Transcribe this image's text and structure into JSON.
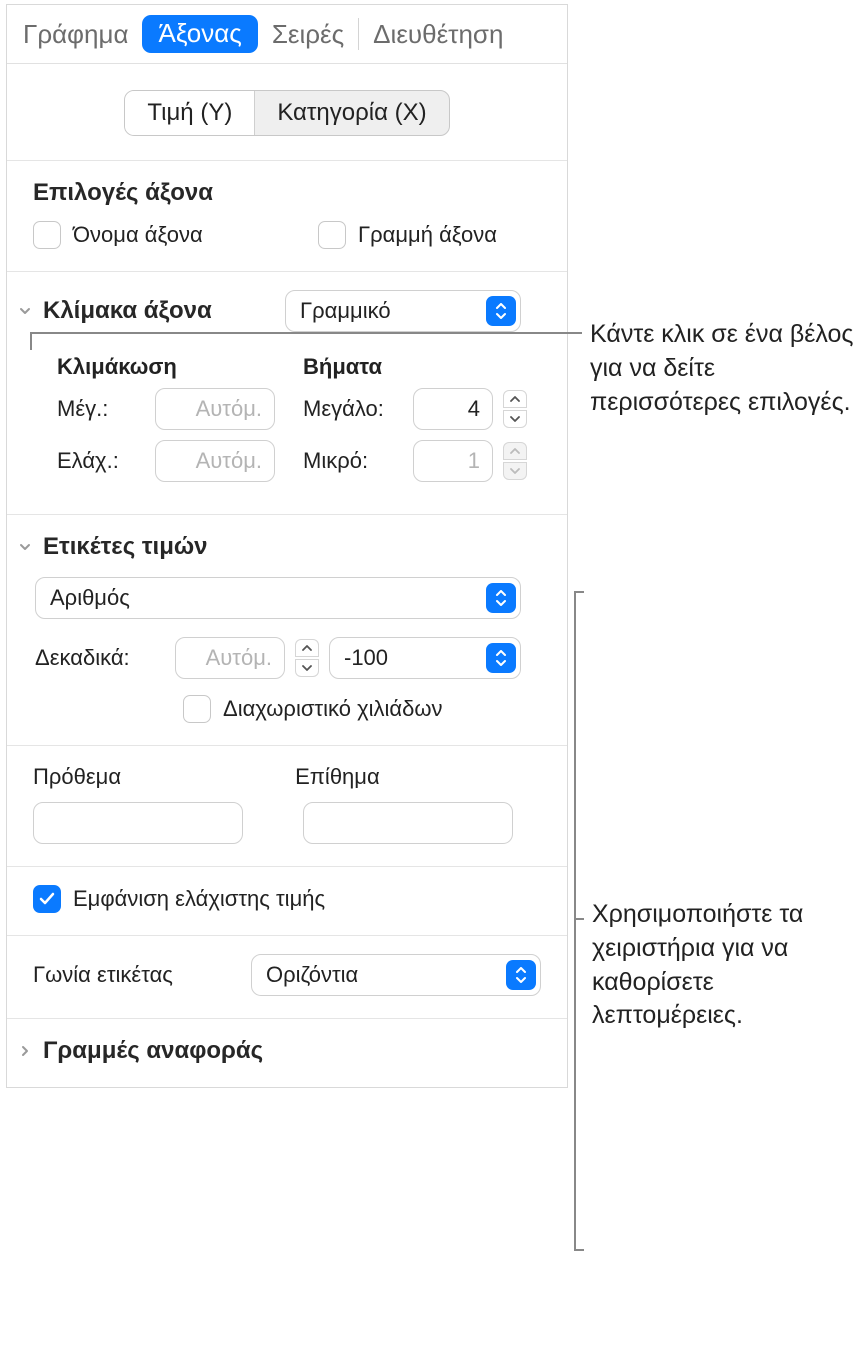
{
  "tabs": {
    "chart": "Γράφημα",
    "axis": "Άξονας",
    "series": "Σειρές",
    "arrange": "Διευθέτηση"
  },
  "segment": {
    "valueY": "Τιμή (Y)",
    "categoryX": "Κατηγορία (X)"
  },
  "axisOptions": {
    "title": "Επιλογές άξονα",
    "axisName": "Όνομα άξονα",
    "axisLine": "Γραμμή άξονα"
  },
  "scale": {
    "title": "Κλίμακα άξονα",
    "type": "Γραμμικό",
    "scalingTitle": "Κλιμάκωση",
    "maxLabel": "Μέγ.:",
    "maxValue": "Αυτόμ.",
    "minLabel": "Ελάχ.:",
    "minValue": "Αυτόμ.",
    "stepsTitle": "Βήματα",
    "majorLabel": "Μεγάλο:",
    "majorValue": "4",
    "minorLabel": "Μικρό:",
    "minorValue": "1"
  },
  "valueLabels": {
    "title": "Ετικέτες τιμών",
    "format": "Αριθμός",
    "decimalsLabel": "Δεκαδικά:",
    "decimalsValue": "Αυτόμ.",
    "negFmt": "-100",
    "thousands": "Διαχωριστικό χιλιάδων",
    "prefix": "Πρόθεμα",
    "suffix": "Επίθημα",
    "showMin": "Εμφάνιση ελάχιστης τιμής"
  },
  "labelAngle": {
    "label": "Γωνία ετικέτας",
    "value": "Οριζόντια"
  },
  "refLines": {
    "title": "Γραμμές αναφοράς"
  },
  "callouts": {
    "c1": "Κάντε κλικ σε ένα βέλος για να δείτε περισσότερες επιλογές.",
    "c2": "Χρησιμοποιήστε τα χειριστήρια για να καθορίσετε λεπτομέρειες."
  }
}
